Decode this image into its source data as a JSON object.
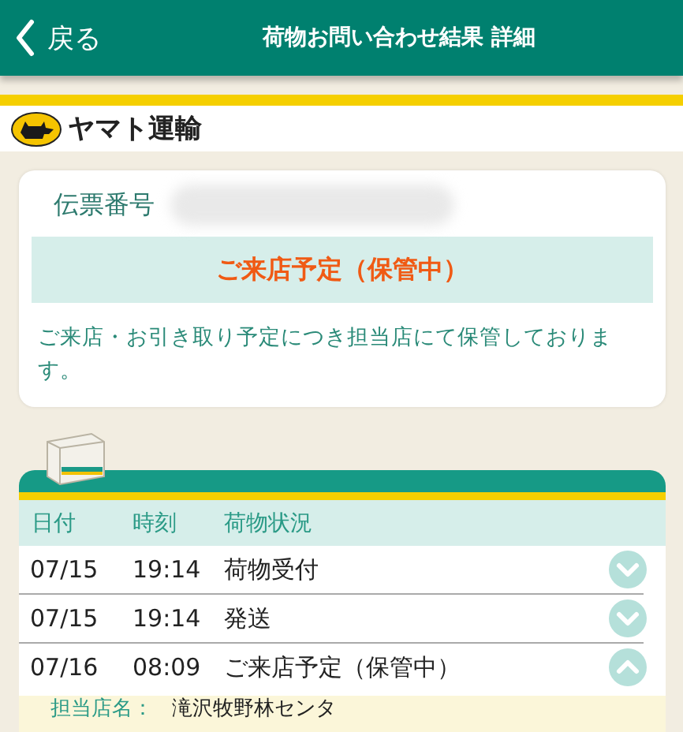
{
  "header": {
    "back": "戻る",
    "title": "荷物お問い合わせ結果 詳細"
  },
  "brand": {
    "name": "ヤマト運輸"
  },
  "summary": {
    "label": "伝票番号",
    "status": "ご来店予定（保管中）",
    "message": "ご来店・お引き取り予定につき担当店にて保管しております。"
  },
  "history": {
    "columns": [
      "日付",
      "時刻",
      "荷物状況"
    ],
    "rows": [
      {
        "date": "07/15",
        "time": "19:14",
        "status": "荷物受付",
        "expanded": false
      },
      {
        "date": "07/15",
        "time": "19:14",
        "status": "発送",
        "expanded": false
      },
      {
        "date": "07/16",
        "time": "08:09",
        "status": "ご来店予定（保管中）",
        "expanded": true
      }
    ],
    "detail": {
      "label": "担当店名：",
      "value": "滝沢牧野林センタ"
    }
  }
}
